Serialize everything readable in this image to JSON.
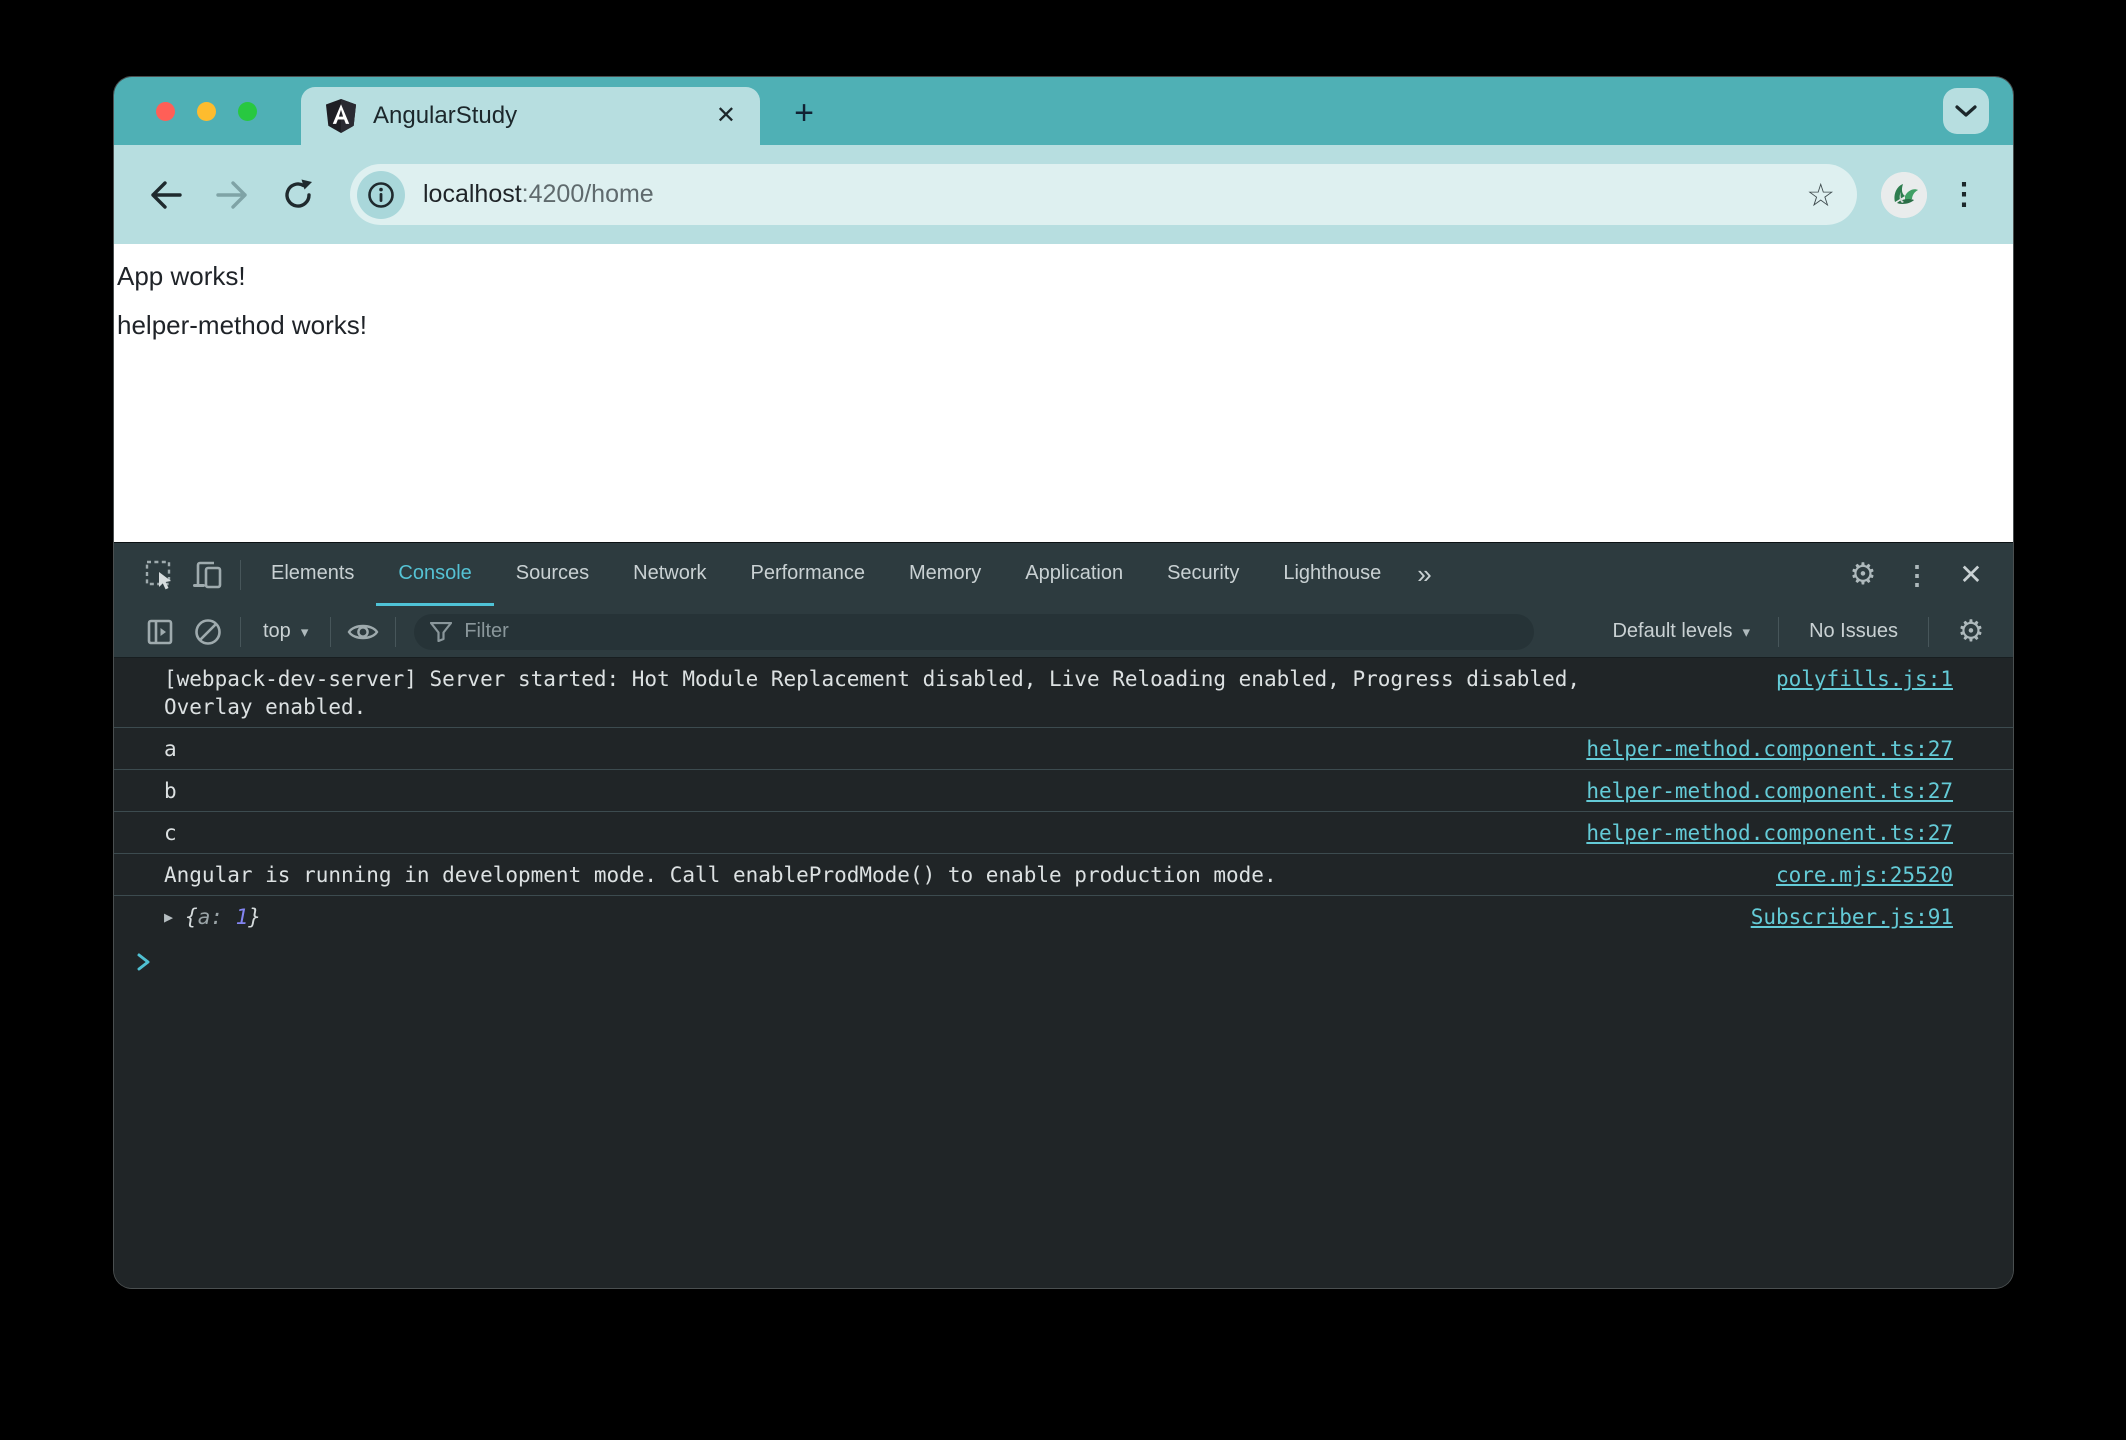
{
  "browser": {
    "tab": {
      "title": "AngularStudy"
    },
    "url": {
      "host": "localhost",
      "path": ":4200/home"
    }
  },
  "page": {
    "line1": "App works!",
    "line2": "helper-method works!"
  },
  "devtools": {
    "tabs": [
      "Elements",
      "Console",
      "Sources",
      "Network",
      "Performance",
      "Memory",
      "Application",
      "Security",
      "Lighthouse"
    ],
    "active_tab": "Console",
    "toolbar": {
      "context": "top",
      "filter_placeholder": "Filter",
      "levels": "Default levels",
      "issues": "No Issues"
    },
    "console": {
      "messages": [
        {
          "text": "[webpack-dev-server] Server started: Hot Module Replacement disabled, Live Reloading enabled, Progress disabled, Overlay enabled.",
          "source": "polyfills.js:1"
        },
        {
          "text": "a",
          "source": "helper-method.component.ts:27"
        },
        {
          "text": "b",
          "source": "helper-method.component.ts:27"
        },
        {
          "text": "c",
          "source": "helper-method.component.ts:27"
        },
        {
          "text": "Angular is running in development mode. Call enableProdMode() to enable production mode.",
          "source": "core.mjs:25520"
        },
        {
          "open": "{",
          "key": "a",
          "sep": ": ",
          "value": "1",
          "close": "}",
          "source": "Subscriber.js:91"
        }
      ]
    }
  },
  "icons": {
    "close": "✕",
    "plus": "+",
    "kebab": "⋮",
    "gear": "⚙",
    "more_tabs": "»",
    "caret": "▾",
    "expand_triangle": "▶",
    "bookmark_star": "☆"
  },
  "colors": {
    "tabstrip": "#4FB0B5",
    "toolbar": "#B7DEE0",
    "urlbar": "#DEF0F0",
    "devtools_bar": "#2D3B3F",
    "console_bg": "#202527",
    "accent_teal": "#55C2D4",
    "link_teal": "#64CBD7",
    "value_purple": "#8385F2"
  }
}
